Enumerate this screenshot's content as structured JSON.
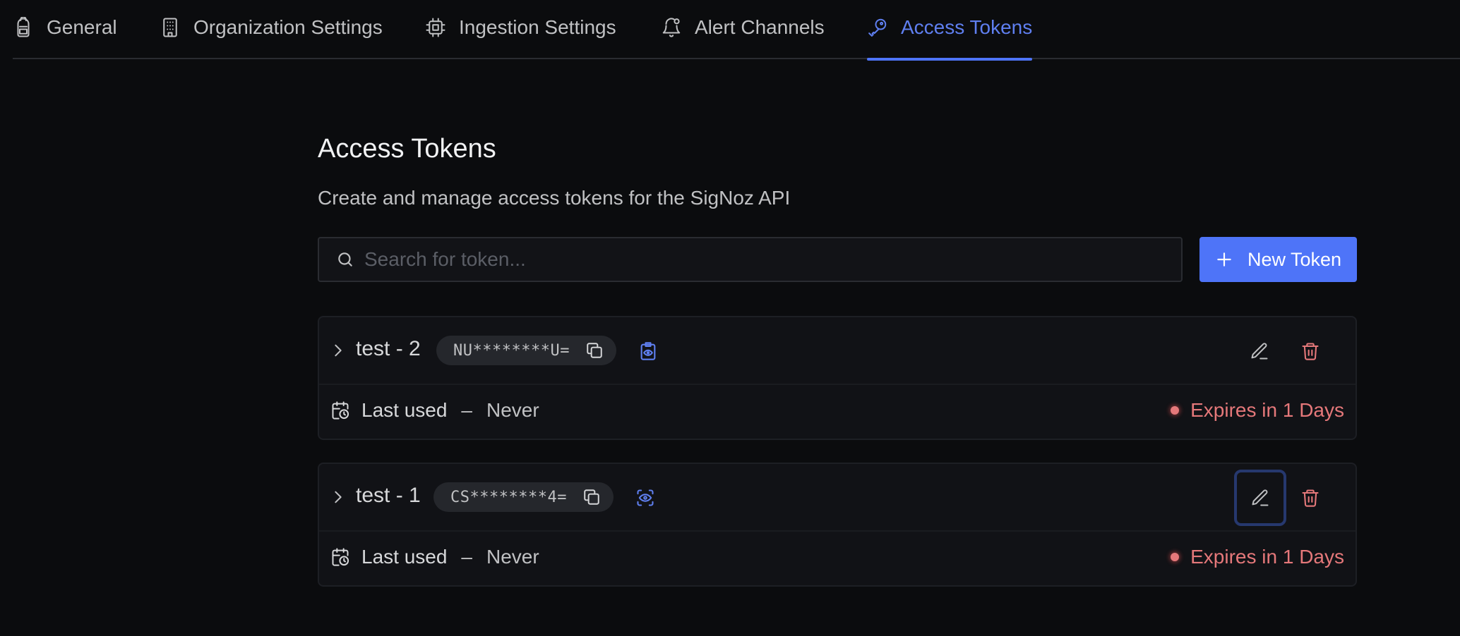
{
  "tabs": [
    {
      "label": "General",
      "icon": "backpack-icon",
      "active": false
    },
    {
      "label": "Organization Settings",
      "icon": "building-icon",
      "active": false
    },
    {
      "label": "Ingestion Settings",
      "icon": "chip-icon",
      "active": false
    },
    {
      "label": "Alert Channels",
      "icon": "bell-icon",
      "active": false
    },
    {
      "label": "Access Tokens",
      "icon": "key-icon",
      "active": true
    }
  ],
  "header": {
    "title": "Access Tokens",
    "subtitle": "Create and manage access tokens for the SigNoz API"
  },
  "search": {
    "placeholder": "Search for token..."
  },
  "new_token_button": {
    "label": "New Token"
  },
  "tokens": [
    {
      "name": "test - 2",
      "masked_token": "NU********U=",
      "last_used_label": "Last used",
      "separator": "–",
      "last_used_value": "Never",
      "expires": "Expires in 1 Days",
      "reveal_icon": "eye-clipboard-icon"
    },
    {
      "name": "test - 1",
      "masked_token": "CS********4=",
      "last_used_label": "Last used",
      "separator": "–",
      "last_used_value": "Never",
      "expires": "Expires in 1 Days",
      "reveal_icon": "eye-scan-icon"
    }
  ],
  "colors": {
    "background": "#0b0c0e",
    "accent": "#4e74f8",
    "active_tab": "#5f7ff0",
    "danger": "#e5787a",
    "card": "#111216"
  }
}
